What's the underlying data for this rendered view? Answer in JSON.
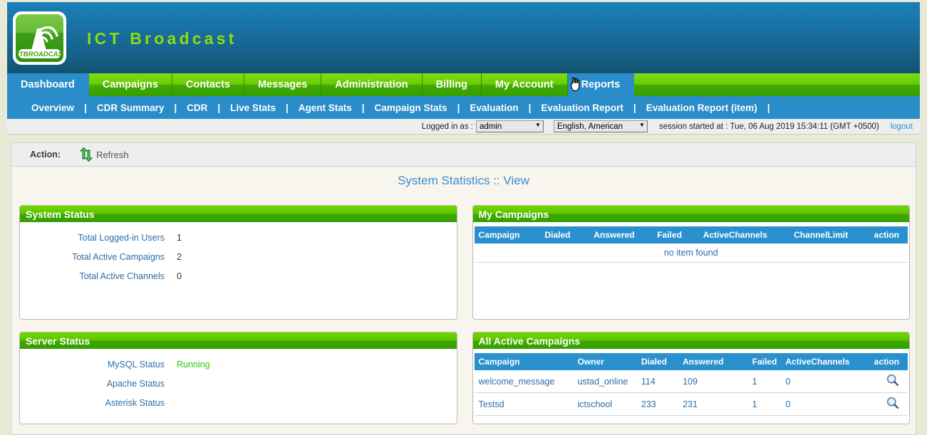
{
  "brand": {
    "title": "ICT Broadcast",
    "logo_text": "ICTBROADCAST",
    "logo_icon": "broadcast-tower-icon"
  },
  "mainnav": {
    "items": [
      {
        "label": "Dashboard",
        "active": true
      },
      {
        "label": "Campaigns",
        "active": false
      },
      {
        "label": "Contacts",
        "active": false
      },
      {
        "label": "Messages",
        "active": false
      },
      {
        "label": "Administration",
        "active": false
      },
      {
        "label": "Billing",
        "active": false
      },
      {
        "label": "My Account",
        "active": false
      },
      {
        "label": "Reports",
        "active": true
      }
    ]
  },
  "subnav": {
    "items": [
      "Overview",
      "CDR Summary",
      "CDR",
      "Live Stats",
      "Agent Stats",
      "Campaign Stats",
      "Evaluation",
      "Evaluation Report",
      "Evaluation Report (item)"
    ],
    "separator": "|"
  },
  "session": {
    "logged_in_label": "Logged in as :",
    "user": "admin",
    "user_options": [
      "admin"
    ],
    "language": "English, American",
    "language_options": [
      "English, American"
    ],
    "session_text": "session started at : Tue, 06 Aug 2019 15:34:11 (GMT +0500)",
    "logout_label": "logout"
  },
  "actionbar": {
    "label": "Action:",
    "refresh_label": "Refresh",
    "refresh_icon": "refresh-icon"
  },
  "page": {
    "title": "System Statistics :: View"
  },
  "panels": {
    "system_status": {
      "title": "System Status",
      "rows": [
        {
          "label": "Total Logged-in Users",
          "value": "1"
        },
        {
          "label": "Total Active Campaigns",
          "value": "2"
        },
        {
          "label": "Total Active Channels",
          "value": "0"
        }
      ]
    },
    "server_status": {
      "title": "Server Status",
      "rows": [
        {
          "label": "MySQL Status",
          "value": "Running",
          "state": "running"
        },
        {
          "label": "Apache Status",
          "value": "",
          "state": ""
        },
        {
          "label": "Asterisk Status",
          "value": "",
          "state": ""
        }
      ]
    },
    "my_campaigns": {
      "title": "My Campaigns",
      "columns": [
        "Campaign",
        "Dialed",
        "Answered",
        "Failed",
        "ActiveChannels",
        "ChannelLimit",
        "action"
      ],
      "rows": [],
      "empty_text": "no item found"
    },
    "all_active_campaigns": {
      "title": "All Active Campaigns",
      "columns": [
        "Campaign",
        "Owner",
        "Dialed",
        "Answered",
        "Failed",
        "ActiveChannels",
        "action"
      ],
      "rows": [
        {
          "campaign": "welcome_message",
          "owner": "ustad_online",
          "dialed": "114",
          "answered": "109",
          "failed": "1",
          "active_channels": "0",
          "action_icon": "magnifier-icon"
        },
        {
          "campaign": "Testsd",
          "owner": "ictschool",
          "dialed": "233",
          "answered": "231",
          "failed": "1",
          "active_channels": "0",
          "action_icon": "magnifier-icon"
        }
      ]
    }
  },
  "colors": {
    "header_blue_top": "#1a7fb9",
    "header_blue_bottom": "#12526f",
    "nav_green": "#5cc300",
    "active_tab_blue": "#2a8cc9",
    "panel_header_green": "#5cc300",
    "link_blue": "#2d6ea5",
    "running_green": "#2fc903",
    "page_bg": "#e9e9d8",
    "content_bg": "#f7f5ee"
  }
}
